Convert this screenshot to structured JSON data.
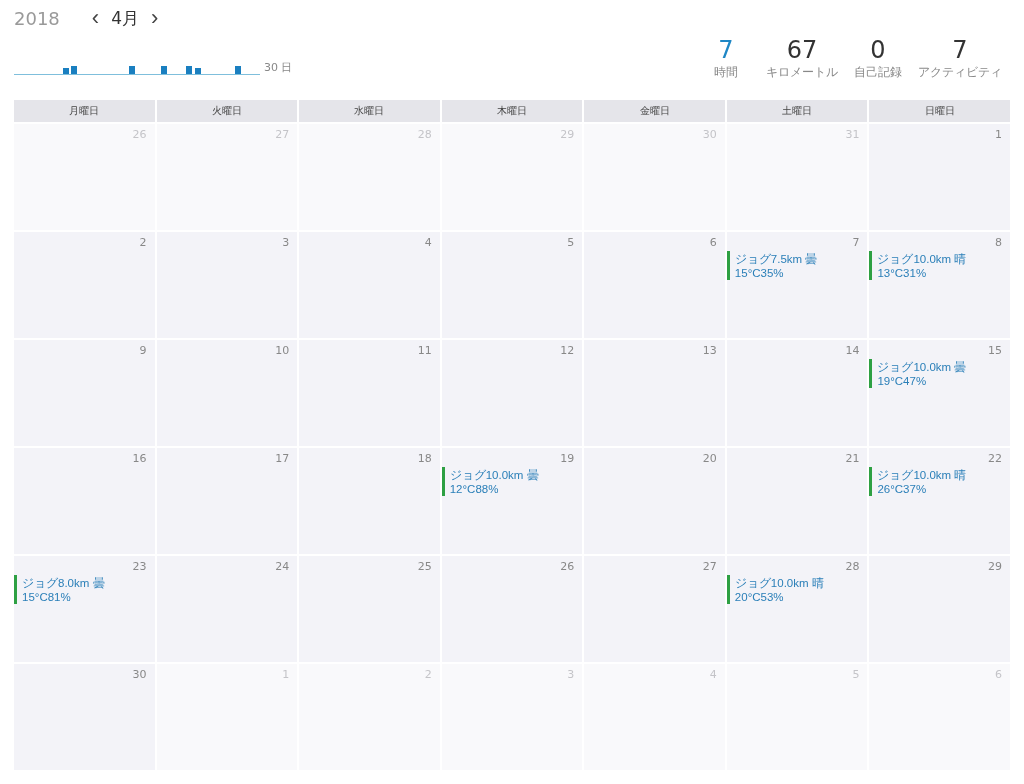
{
  "header": {
    "year": "2018",
    "prev": "‹",
    "month": "4月",
    "next": "›",
    "sparkline_label": "30 日"
  },
  "stats": [
    {
      "value": "7",
      "label": "時間",
      "selected": true
    },
    {
      "value": "67",
      "label": "キロメートル",
      "selected": false
    },
    {
      "value": "0",
      "label": "自己記録",
      "selected": false
    },
    {
      "value": "7",
      "label": "アクティビティ",
      "selected": false
    }
  ],
  "weekdays": [
    "月曜日",
    "火曜日",
    "水曜日",
    "木曜日",
    "金曜日",
    "土曜日",
    "日曜日"
  ],
  "weeks": [
    [
      {
        "day": "26",
        "in_month": false
      },
      {
        "day": "27",
        "in_month": false
      },
      {
        "day": "28",
        "in_month": false
      },
      {
        "day": "29",
        "in_month": false
      },
      {
        "day": "30",
        "in_month": false
      },
      {
        "day": "31",
        "in_month": false
      },
      {
        "day": "1",
        "in_month": true
      }
    ],
    [
      {
        "day": "2",
        "in_month": true
      },
      {
        "day": "3",
        "in_month": true
      },
      {
        "day": "4",
        "in_month": true
      },
      {
        "day": "5",
        "in_month": true
      },
      {
        "day": "6",
        "in_month": true
      },
      {
        "day": "7",
        "in_month": true,
        "events": [
          "ジョグ7.5km 曇15°C35%"
        ]
      },
      {
        "day": "8",
        "in_month": true,
        "events": [
          "ジョグ10.0km 晴13°C31%"
        ]
      }
    ],
    [
      {
        "day": "9",
        "in_month": true
      },
      {
        "day": "10",
        "in_month": true
      },
      {
        "day": "11",
        "in_month": true
      },
      {
        "day": "12",
        "in_month": true
      },
      {
        "day": "13",
        "in_month": true
      },
      {
        "day": "14",
        "in_month": true
      },
      {
        "day": "15",
        "in_month": true,
        "events": [
          "ジョグ10.0km 曇19°C47%"
        ]
      }
    ],
    [
      {
        "day": "16",
        "in_month": true
      },
      {
        "day": "17",
        "in_month": true
      },
      {
        "day": "18",
        "in_month": true
      },
      {
        "day": "19",
        "in_month": true,
        "events": [
          "ジョグ10.0km 曇12°C88%"
        ]
      },
      {
        "day": "20",
        "in_month": true
      },
      {
        "day": "21",
        "in_month": true
      },
      {
        "day": "22",
        "in_month": true,
        "events": [
          "ジョグ10.0km 晴26°C37%"
        ]
      }
    ],
    [
      {
        "day": "23",
        "in_month": true,
        "events": [
          "ジョグ8.0km 曇15°C81%"
        ]
      },
      {
        "day": "24",
        "in_month": true
      },
      {
        "day": "25",
        "in_month": true
      },
      {
        "day": "26",
        "in_month": true
      },
      {
        "day": "27",
        "in_month": true
      },
      {
        "day": "28",
        "in_month": true,
        "events": [
          "ジョグ10.0km 晴20°C53%"
        ]
      },
      {
        "day": "29",
        "in_month": true
      }
    ],
    [
      {
        "day": "30",
        "in_month": true
      },
      {
        "day": "1",
        "in_month": false
      },
      {
        "day": "2",
        "in_month": false
      },
      {
        "day": "3",
        "in_month": false
      },
      {
        "day": "4",
        "in_month": false
      },
      {
        "day": "5",
        "in_month": false
      },
      {
        "day": "6",
        "in_month": false
      }
    ]
  ]
}
